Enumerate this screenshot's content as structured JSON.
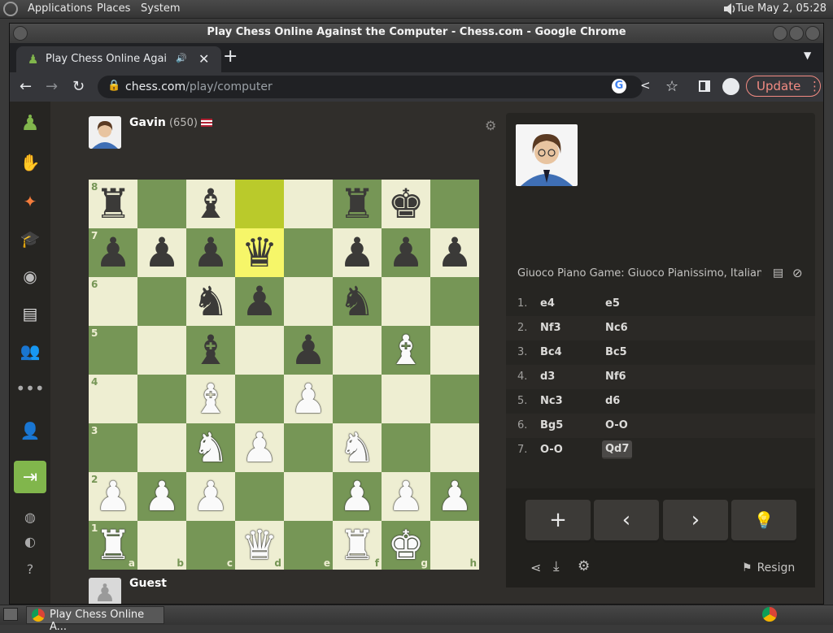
{
  "os": {
    "menus": [
      "Applications",
      "Places",
      "System"
    ],
    "clock": "Tue May  2, 05:28"
  },
  "window": {
    "title": "Play Chess Online Against the Computer - Chess.com - Google Chrome"
  },
  "browser": {
    "tab_title": "Play Chess Online Agains",
    "url_host": "chess.com",
    "url_path": "/play/computer",
    "update_label": "Update"
  },
  "players": {
    "top": {
      "name": "Gavin",
      "rating": "(650)",
      "flag": "us-flag"
    },
    "bottom": {
      "name": "Guest"
    }
  },
  "board": {
    "files": [
      "a",
      "b",
      "c",
      "d",
      "e",
      "f",
      "g",
      "h"
    ],
    "ranks": [
      "8",
      "7",
      "6",
      "5",
      "4",
      "3",
      "2",
      "1"
    ],
    "highlight": [
      "d8",
      "d7"
    ],
    "pieces": {
      "a8": "bR",
      "c8": "bB",
      "f8": "bR",
      "g8": "bK",
      "a7": "bP",
      "b7": "bP",
      "c7": "bP",
      "d7": "bQ",
      "f7": "bP",
      "g7": "bP",
      "h7": "bP",
      "c6": "bN",
      "d6": "bP",
      "f6": "bN",
      "c5": "bB",
      "e5": "bP",
      "g5": "wB",
      "c4": "wB",
      "e4": "wP",
      "c3": "wN",
      "d3": "wP",
      "f3": "wN",
      "a2": "wP",
      "b2": "wP",
      "c2": "wP",
      "f2": "wP",
      "g2": "wP",
      "h2": "wP",
      "a1": "wR",
      "d1": "wQ",
      "f1": "wR",
      "g1": "wK"
    },
    "colors": {
      "light": "#eeeed2",
      "dark": "#769656"
    }
  },
  "panel": {
    "opening": "Giuoco Piano Game: Giuoco Pianissimo, Italian ...",
    "moves": [
      {
        "num": "1.",
        "white": "e4",
        "black": "e5"
      },
      {
        "num": "2.",
        "white": "Nf3",
        "black": "Nc6"
      },
      {
        "num": "3.",
        "white": "Bc4",
        "black": "Bc5"
      },
      {
        "num": "4.",
        "white": "d3",
        "black": "Nf6"
      },
      {
        "num": "5.",
        "white": "Nc3",
        "black": "d6"
      },
      {
        "num": "6.",
        "white": "Bg5",
        "black": "O-O"
      },
      {
        "num": "7.",
        "white": "O-O",
        "black": "Qd7"
      }
    ],
    "resign_label": "Resign"
  },
  "taskbar": {
    "item_label": "Play Chess Online A..."
  }
}
